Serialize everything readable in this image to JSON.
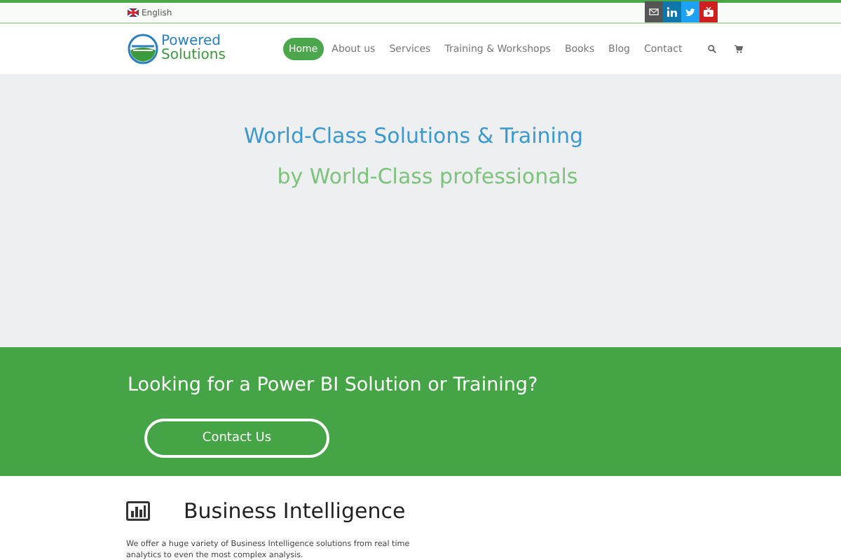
{
  "top_bar": {
    "language": "English"
  },
  "logo": {
    "line_1": "Powered",
    "line_2": "Solutions"
  },
  "nav": [
    {
      "label": "Home",
      "selected": true
    },
    {
      "label": "About us",
      "selected": false
    },
    {
      "label": "Services",
      "selected": false
    },
    {
      "label": "Training & Workshops",
      "selected": false
    },
    {
      "label": "Books",
      "selected": false
    },
    {
      "label": "Blog",
      "selected": false
    },
    {
      "label": "Contact",
      "selected": false
    }
  ],
  "hero": {
    "title": "World-Class Solutions & Training",
    "subtitle": "by World-Class professionals"
  },
  "cta": {
    "heading": "Looking for a Power BI Solution or Training?",
    "button": "Contact Us"
  },
  "feature": {
    "title": "Business Intelligence",
    "text": "We offer a huge variety of Business Intelligence solutions from real time analytics to even the most complex analysis."
  }
}
